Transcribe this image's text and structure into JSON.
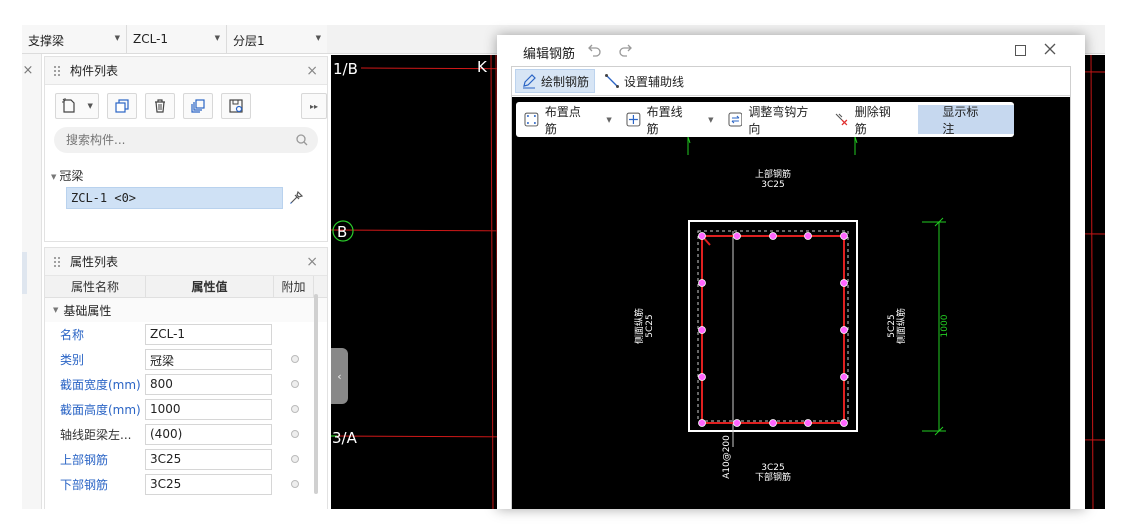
{
  "topbar": {
    "type_select": "支撑梁",
    "component_select": "ZCL-1",
    "layer_select": "分层1"
  },
  "component_panel": {
    "title": "构件列表",
    "search_placeholder": "搜索构件...",
    "tree_group": "冠梁",
    "tree_item": "ZCL-1 <0>"
  },
  "property_panel": {
    "title": "属性列表",
    "col_name": "属性名称",
    "col_value": "属性值",
    "col_extra": "附加",
    "group": "基础属性",
    "rows": [
      {
        "name": "名称",
        "value": "ZCL-1"
      },
      {
        "name": "类别",
        "value": "冠梁"
      },
      {
        "name": "截面宽度(mm)",
        "value": "800"
      },
      {
        "name": "截面高度(mm)",
        "value": "1000"
      },
      {
        "name": "轴线距梁左...",
        "value": "(400)"
      },
      {
        "name": "上部钢筋",
        "value": "3C25"
      },
      {
        "name": "下部钢筋",
        "value": "3C25"
      }
    ]
  },
  "canvas": {
    "axis_labels": [
      "1/B",
      "B",
      "3/A",
      "K"
    ]
  },
  "dialog": {
    "title": "编辑钢筋",
    "tab_draw": "绘制钢筋",
    "tab_aux": "设置辅助线",
    "tools": {
      "point_rebar": "布置点筋",
      "line_rebar": "布置线筋",
      "hook_dir": "调整弯钩方向",
      "delete_rebar": "删除钢筋",
      "show_label": "显示标注"
    },
    "drawing": {
      "top_label": "上部钢筋",
      "top_value": "3C25",
      "bottom_label": "下部钢筋",
      "bottom_value": "3C25",
      "left_label": "侧面纵筋",
      "left_value": "5C25",
      "right_label": "侧面纵筋",
      "right_value": "5C25",
      "stirrup": "A10@200",
      "dimension": "1000"
    }
  },
  "colors": {
    "accent_blue": "#2a64c5",
    "selection": "#cfe1f5",
    "cad_bg": "#000000",
    "axis_red": "#d01818",
    "rebar_red": "#e02020",
    "rebar_dot": "#ff66ff",
    "dim_green": "#22cc22"
  }
}
